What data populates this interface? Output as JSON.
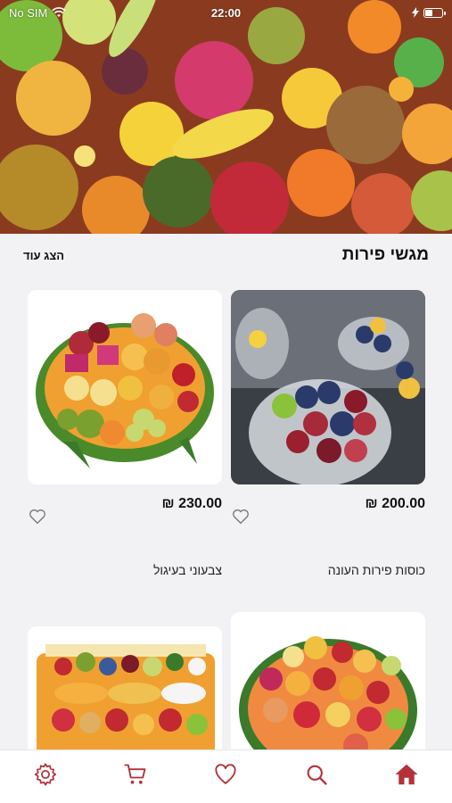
{
  "status_bar": {
    "carrier": "No SIM",
    "time": "22:00"
  },
  "section": {
    "title": "מגשי פירות",
    "show_more": "הצג עוד"
  },
  "products": [
    {
      "name": "כוסות פירות העונה",
      "price": "200.00 ₪"
    },
    {
      "name": "צבעוני בעיגול",
      "price": "230.00 ₪"
    },
    {
      "name": "",
      "price": ""
    },
    {
      "name": "",
      "price": ""
    }
  ],
  "tab_bar": {
    "items": [
      "home-icon",
      "search-icon",
      "heart-icon",
      "cart-icon",
      "gear-icon"
    ],
    "active": "home-icon"
  },
  "colors": {
    "accent": "#b3323a",
    "background": "#f2f2f4",
    "tab_background": "#ffffff"
  }
}
